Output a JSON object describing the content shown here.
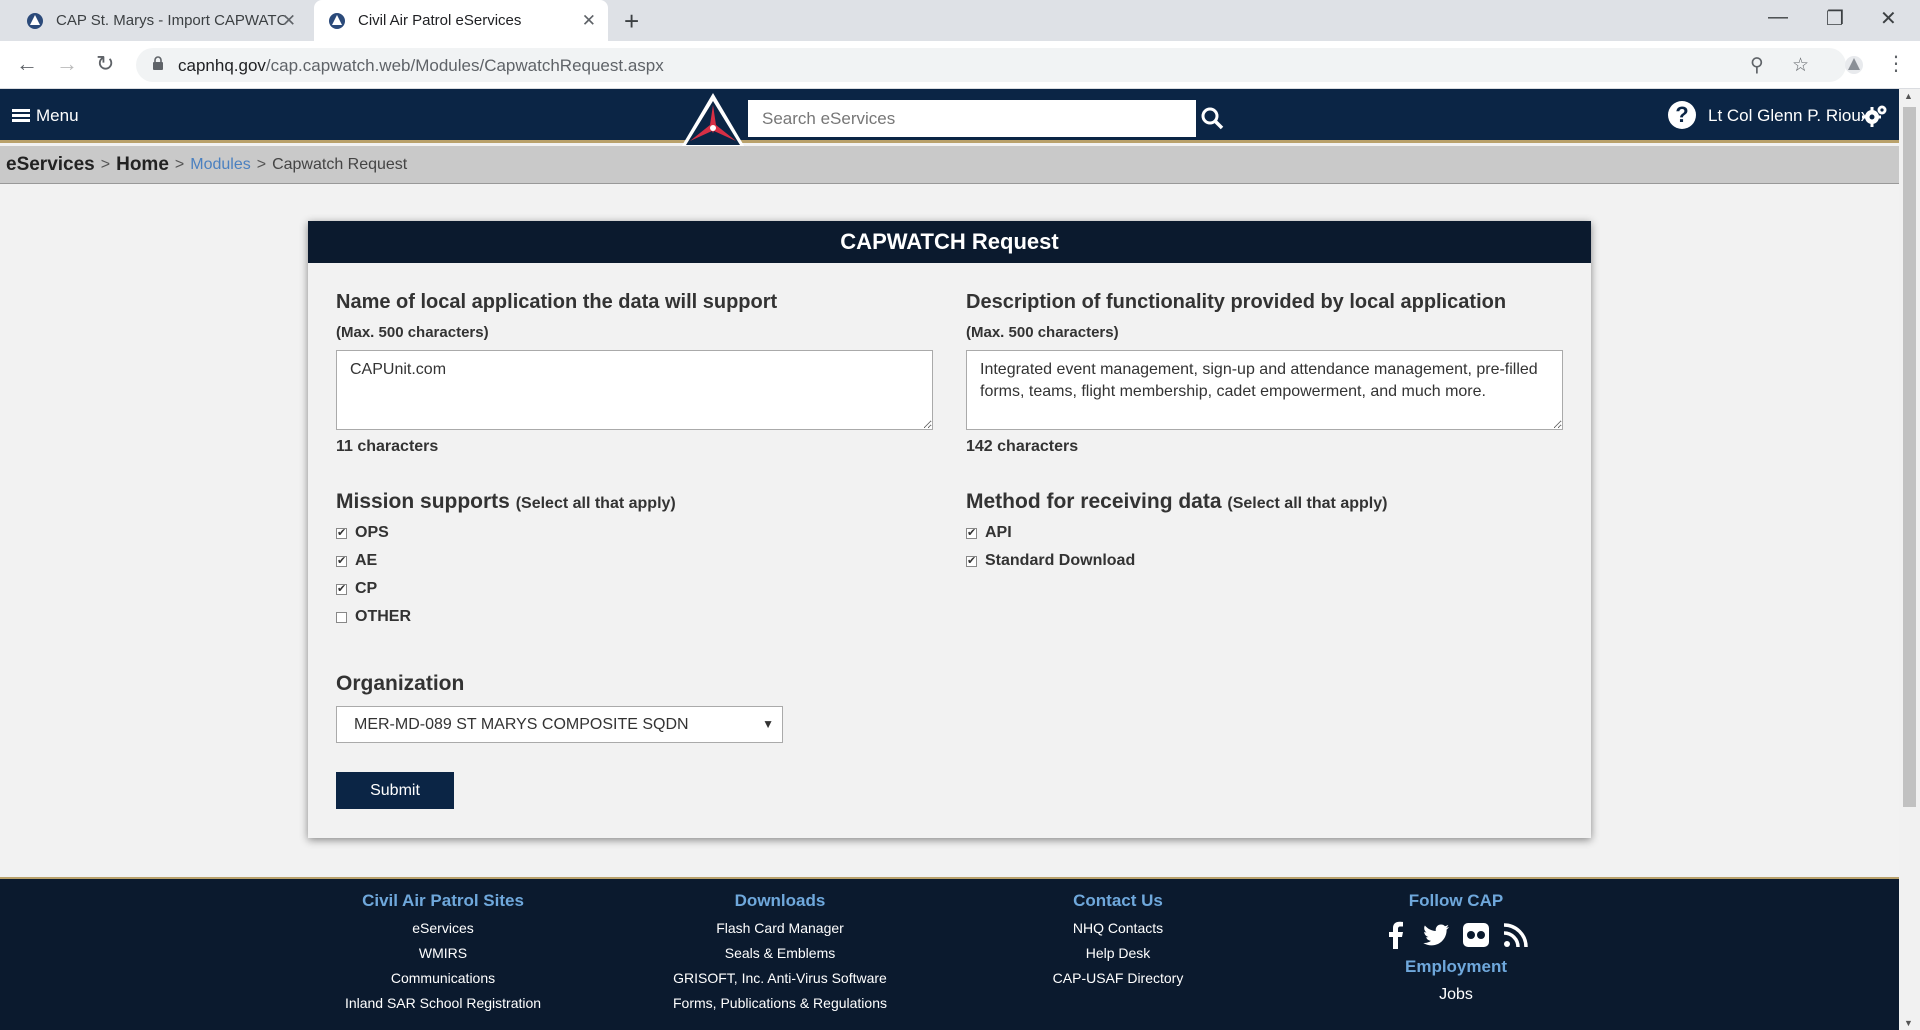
{
  "browser": {
    "tabs": [
      {
        "title": "CAP St. Marys - Import CAPWATC",
        "active": false
      },
      {
        "title": "Civil Air Patrol eServices",
        "active": true
      }
    ],
    "url_domain": "capnhq.gov",
    "url_path": "/cap.capwatch.web/Modules/CapwatchRequest.aspx"
  },
  "header": {
    "menu_label": "Menu",
    "search_placeholder": "Search eServices",
    "user_name": "Lt Col Glenn P. Rioux",
    "help_symbol": "?"
  },
  "breadcrumb": {
    "root": "eServices",
    "home": "Home",
    "modules": "Modules",
    "current": "Capwatch Request",
    "separator": ">"
  },
  "form": {
    "title": "CAPWATCH Request",
    "app_name": {
      "label": "Name of local application the data will support",
      "hint": "(Max. 500 characters)",
      "value": "CAPUnit.com",
      "count": "11 characters"
    },
    "description": {
      "label": "Description of functionality provided by local application",
      "hint": "(Max. 500 characters)",
      "value": "Integrated event management, sign-up and attendance management, pre-filled forms, teams, flight membership, cadet empowerment, and much more.",
      "count": "142 characters"
    },
    "mission": {
      "label": "Mission supports",
      "sub": "(Select all that apply)",
      "options": [
        {
          "label": "OPS",
          "checked": true
        },
        {
          "label": "AE",
          "checked": true
        },
        {
          "label": "CP",
          "checked": true
        },
        {
          "label": "OTHER",
          "checked": false
        }
      ]
    },
    "method": {
      "label": "Method for receiving data",
      "sub": "(Select all that apply)",
      "options": [
        {
          "label": "API",
          "checked": true
        },
        {
          "label": "Standard Download",
          "checked": true
        }
      ]
    },
    "organization": {
      "label": "Organization",
      "selected": "MER-MD-089 ST MARYS COMPOSITE SQDN"
    },
    "submit_label": "Submit"
  },
  "footer": {
    "sites": {
      "heading": "Civil Air Patrol Sites",
      "links": [
        "eServices",
        "WMIRS",
        "Communications",
        "Inland SAR School Registration"
      ]
    },
    "downloads": {
      "heading": "Downloads",
      "links": [
        "Flash Card Manager",
        "Seals & Emblems",
        "GRISOFT, Inc. Anti-Virus Software",
        "Forms, Publications & Regulations"
      ]
    },
    "contact": {
      "heading": "Contact Us",
      "links": [
        "NHQ Contacts",
        "Help Desk",
        "CAP-USAF Directory"
      ]
    },
    "follow": {
      "heading": "Follow CAP",
      "social": [
        "facebook-icon",
        "twitter-icon",
        "flickr-icon",
        "rss-icon"
      ]
    },
    "employment": {
      "heading": "Employment",
      "links": [
        "Jobs"
      ]
    }
  },
  "colors": {
    "header_bg": "#0b2545",
    "card_title_bg": "#0b1a2e",
    "accent_gold": "#b9a16b",
    "link_blue": "#4a80c0",
    "footer_heading": "#6fa8dc"
  }
}
